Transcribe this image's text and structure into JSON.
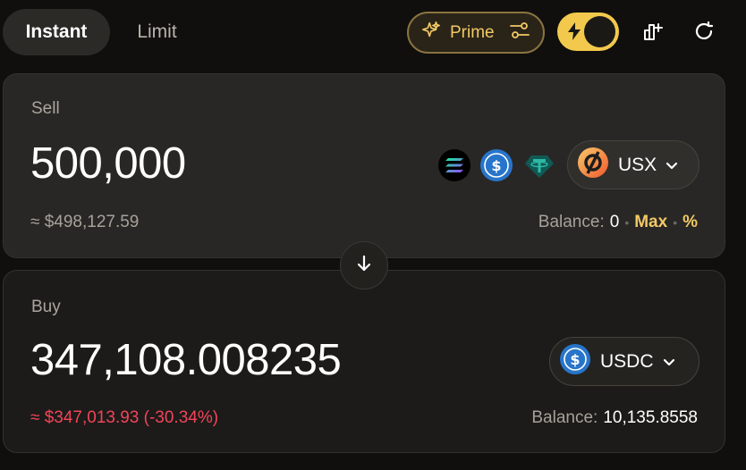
{
  "tabs": {
    "instant": "Instant",
    "limit": "Limit"
  },
  "prime": {
    "label": "Prime"
  },
  "colors": {
    "accent": "#f2c965",
    "negative": "#f2445a"
  },
  "sell": {
    "label": "Sell",
    "amount": "500,000",
    "fiat": "≈ $498,127.59",
    "balance_label": "Balance:",
    "balance_value": "0",
    "max": "Max",
    "percent": "%",
    "token": "USX",
    "quick_tokens": [
      "solana-icon",
      "usdc-icon",
      "usdt-icon"
    ]
  },
  "buy": {
    "label": "Buy",
    "amount": "347,108.008235",
    "fiat": "≈ $347,013.93 (-30.34%)",
    "balance_label": "Balance:",
    "balance_value": "10,135.8558",
    "token": "USDC"
  }
}
